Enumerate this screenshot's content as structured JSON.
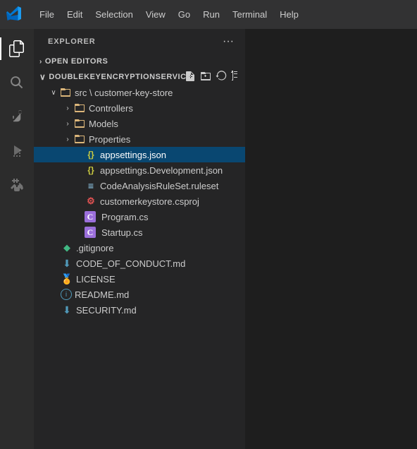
{
  "menubar": {
    "logo_label": "VS Code",
    "items": [
      {
        "label": "File",
        "id": "file"
      },
      {
        "label": "Edit",
        "id": "edit"
      },
      {
        "label": "Selection",
        "id": "selection"
      },
      {
        "label": "View",
        "id": "view"
      },
      {
        "label": "Go",
        "id": "go"
      },
      {
        "label": "Run",
        "id": "run"
      },
      {
        "label": "Terminal",
        "id": "terminal"
      },
      {
        "label": "Help",
        "id": "help"
      }
    ]
  },
  "activity_bar": {
    "icons": [
      {
        "name": "explorer-icon",
        "symbol": "⎘",
        "active": true
      },
      {
        "name": "search-icon",
        "symbol": "🔍",
        "active": false
      },
      {
        "name": "source-control-icon",
        "symbol": "⎇",
        "active": false
      },
      {
        "name": "run-debug-icon",
        "symbol": "▷",
        "active": false
      },
      {
        "name": "extensions-icon",
        "symbol": "⊞",
        "active": false
      }
    ]
  },
  "sidebar": {
    "title": "EXPLORER",
    "more_actions_label": "···",
    "sections": {
      "open_editors": {
        "label": "OPEN EDITORS",
        "collapsed": true
      },
      "workspace": {
        "label": "DOUBLEKEYENCRYPTIONSERVICE",
        "expanded": true,
        "path_label": "src \\ customer-key-store",
        "items": [
          {
            "id": "controllers",
            "type": "folder",
            "label": "Controllers",
            "indent": 2,
            "has_chevron": true,
            "collapsed": true
          },
          {
            "id": "models",
            "type": "folder",
            "label": "Models",
            "indent": 2,
            "has_chevron": true,
            "collapsed": true
          },
          {
            "id": "properties",
            "type": "folder",
            "label": "Properties",
            "indent": 2,
            "has_chevron": true,
            "collapsed": true
          },
          {
            "id": "appsettings-json",
            "type": "json",
            "label": "appsettings.json",
            "indent": 2,
            "selected": true,
            "icon_symbol": "{}",
            "icon_class": "icon-json"
          },
          {
            "id": "appsettings-dev-json",
            "type": "json",
            "label": "appsettings.Development.json",
            "indent": 2,
            "icon_symbol": "{}",
            "icon_class": "icon-json"
          },
          {
            "id": "codeanalysis-ruleset",
            "type": "ruleset",
            "label": "CodeAnalysisRuleSet.ruleset",
            "indent": 2,
            "icon_symbol": "≡",
            "icon_class": "icon-ruleset"
          },
          {
            "id": "csproj",
            "type": "csproj",
            "label": "customerkeystore.csproj",
            "indent": 2,
            "icon_symbol": "⚙",
            "icon_class": "icon-csproj"
          },
          {
            "id": "program-cs",
            "type": "cs",
            "label": "Program.cs",
            "indent": 2,
            "icon_symbol": "C",
            "icon_class": "icon-cs"
          },
          {
            "id": "startup-cs",
            "type": "cs",
            "label": "Startup.cs",
            "indent": 2,
            "icon_symbol": "C",
            "icon_class": "icon-cs"
          },
          {
            "id": "gitignore",
            "type": "git",
            "label": ".gitignore",
            "indent": 1,
            "icon_symbol": "◆",
            "icon_class": "icon-git"
          },
          {
            "id": "code-of-conduct",
            "type": "md",
            "label": "CODE_OF_CONDUCT.md",
            "indent": 1,
            "icon_symbol": "⬇",
            "icon_class": "icon-md-blue"
          },
          {
            "id": "license",
            "type": "license",
            "label": "LICENSE",
            "indent": 1,
            "icon_symbol": "🏅",
            "icon_class": "icon-license"
          },
          {
            "id": "readme",
            "type": "md",
            "label": "README.md",
            "indent": 1,
            "icon_symbol": "ℹ",
            "icon_class": "icon-md-blue"
          },
          {
            "id": "security",
            "type": "md",
            "label": "SECURITY.md",
            "indent": 1,
            "icon_symbol": "⬇",
            "icon_class": "icon-md-blue"
          }
        ]
      }
    }
  }
}
